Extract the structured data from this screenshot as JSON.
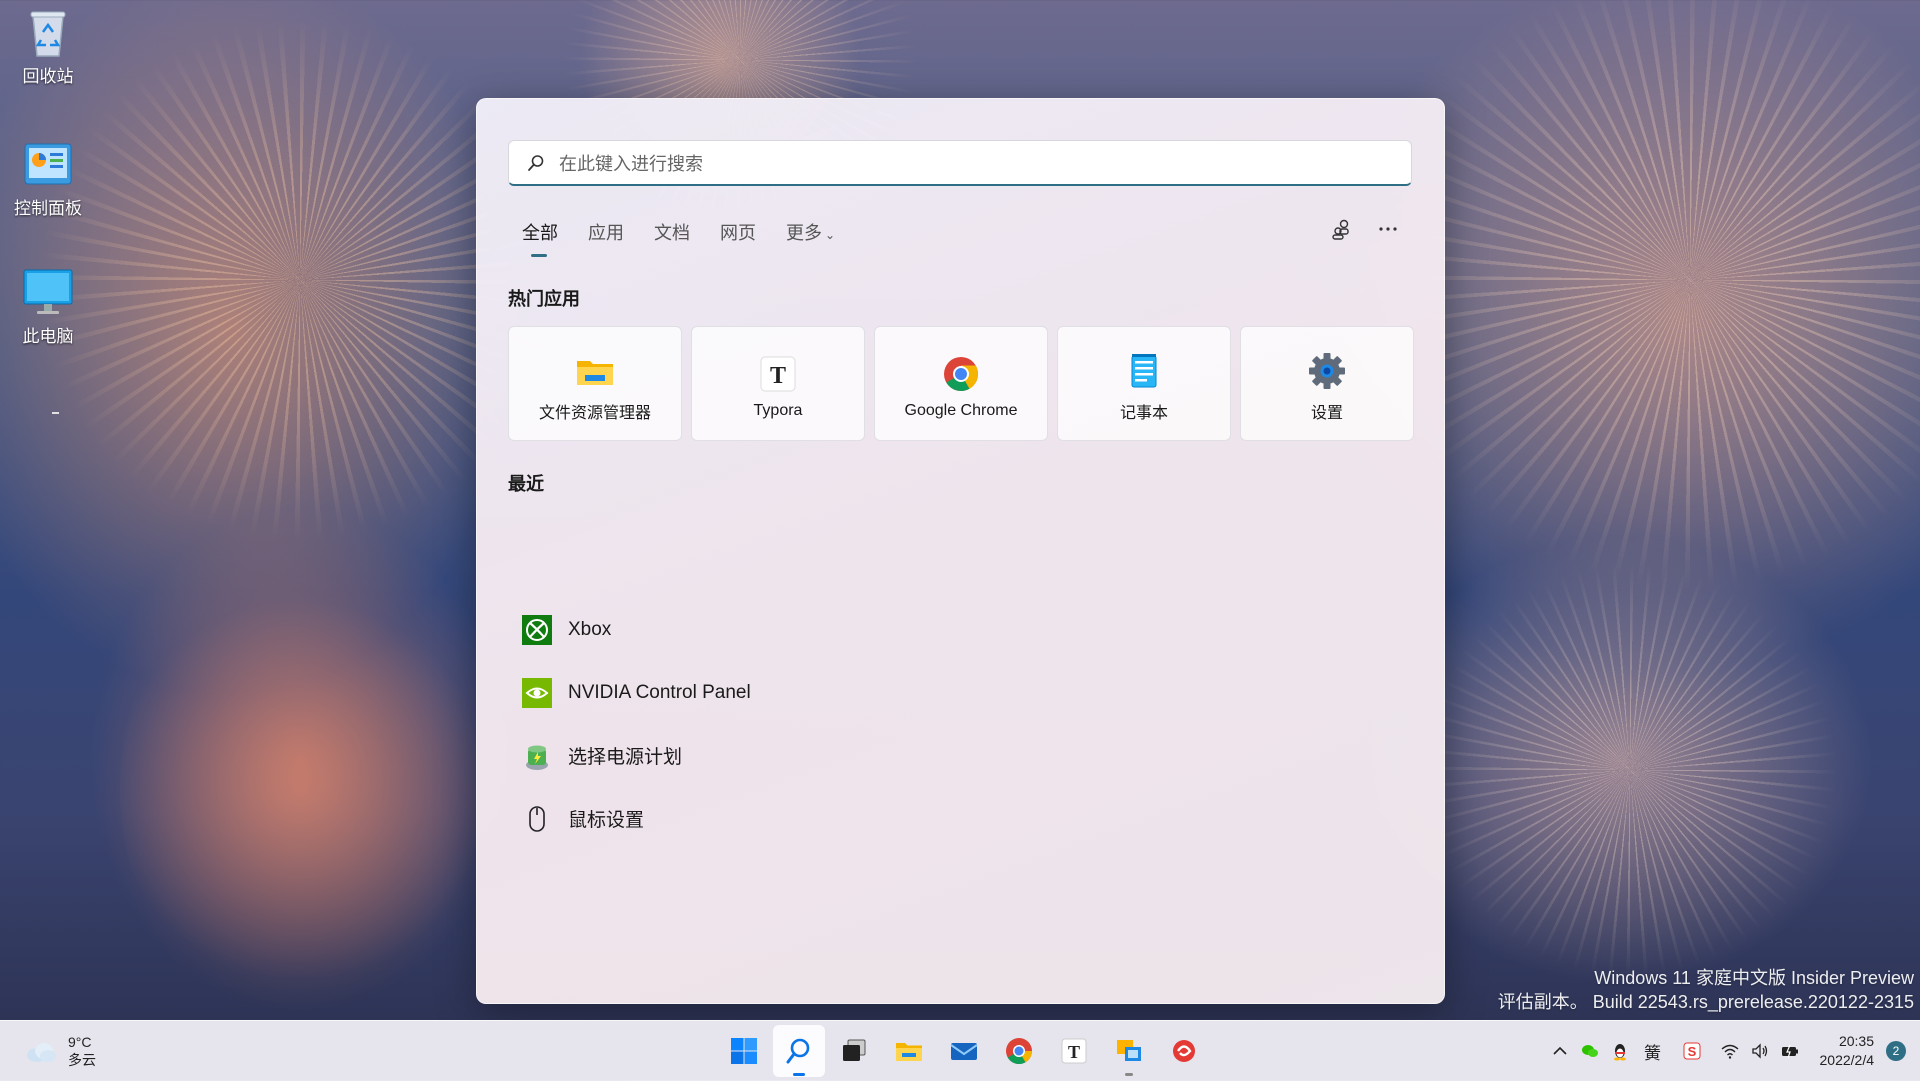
{
  "desktop": {
    "icons": [
      {
        "label": "回收站"
      },
      {
        "label": "控制面板"
      },
      {
        "label": "此电脑"
      }
    ],
    "watermark": {
      "line1": "Windows 11 家庭中文版 Insider Preview",
      "line2": "评估副本。 Build 22543.rs_prerelease.220122-2315"
    }
  },
  "search": {
    "placeholder": "在此键入进行搜索",
    "value": "",
    "tabs": [
      {
        "label": "全部",
        "active": true
      },
      {
        "label": "应用"
      },
      {
        "label": "文档"
      },
      {
        "label": "网页"
      },
      {
        "label": "更多"
      }
    ],
    "top_section_title": "热门应用",
    "top_apps": [
      {
        "label": "文件资源管理器",
        "icon": "file-explorer-icon"
      },
      {
        "label": "Typora",
        "icon": "typora-icon"
      },
      {
        "label": "Google Chrome",
        "icon": "chrome-icon"
      },
      {
        "label": "记事本",
        "icon": "notepad-icon"
      },
      {
        "label": "设置",
        "icon": "settings-gear-icon"
      }
    ],
    "recent_section_title": "最近",
    "recent": [
      {
        "label": "Xbox",
        "icon": "xbox-icon"
      },
      {
        "label": "NVIDIA Control Panel",
        "icon": "nvidia-icon"
      },
      {
        "label": "选择电源计划",
        "icon": "power-plan-icon"
      },
      {
        "label": "鼠标设置",
        "icon": "mouse-icon"
      }
    ]
  },
  "taskbar": {
    "weather": {
      "temp": "9°C",
      "condition": "多云"
    },
    "pinned": [
      {
        "name": "start",
        "icon": "windows-logo-icon"
      },
      {
        "name": "search",
        "icon": "search-icon",
        "active": true
      },
      {
        "name": "task-view",
        "icon": "task-view-icon"
      },
      {
        "name": "file-explorer",
        "icon": "folder-icon"
      },
      {
        "name": "mail",
        "icon": "mail-icon"
      },
      {
        "name": "chrome",
        "icon": "chrome-icon"
      },
      {
        "name": "typora",
        "icon": "typora-icon"
      },
      {
        "name": "remote",
        "icon": "remote-app-icon",
        "running": true
      },
      {
        "name": "app-red",
        "icon": "red-app-icon"
      }
    ],
    "tray": {
      "ime": "簧",
      "time": "20:35",
      "date": "2022/2/4",
      "notification_count": "2"
    }
  },
  "colors": {
    "accent": "#2f6f86",
    "xbox_green": "#107c10",
    "nvidia_green": "#76b900"
  }
}
